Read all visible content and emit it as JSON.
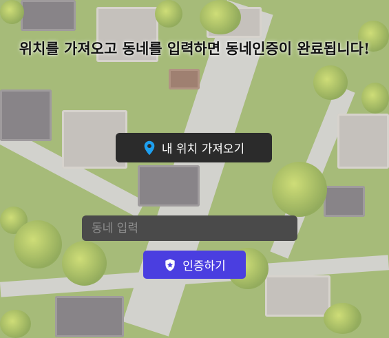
{
  "title": "위치를 가져오고 동네를 입력하면 동네인증이 완료됩니다!",
  "location_button": {
    "label": "내 위치 가져오기",
    "icon": "location-pin-icon",
    "icon_color": "#1ea0f0"
  },
  "neighborhood_input": {
    "placeholder": "동네 입력",
    "value": ""
  },
  "verify_button": {
    "label": "인증하기",
    "icon": "shield-badge-icon",
    "color": "#4a3ee0"
  }
}
